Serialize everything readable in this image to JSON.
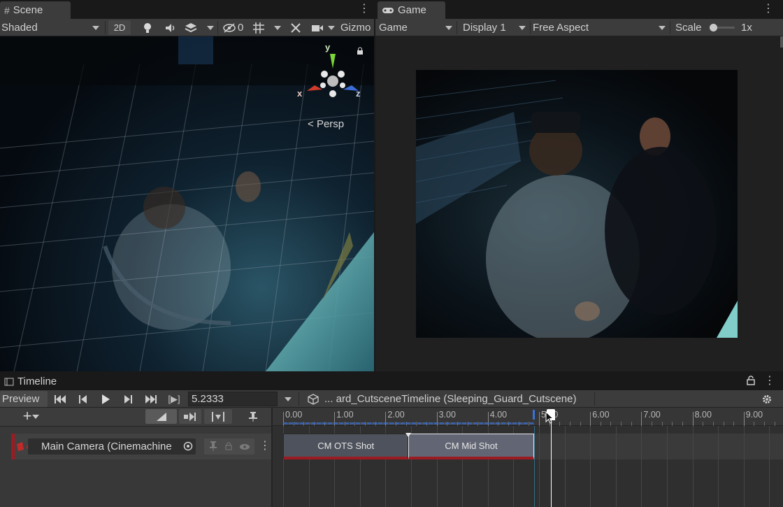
{
  "scene": {
    "tab_label": "Scene",
    "shading_mode": "Shaded",
    "btn_2d": "2D",
    "hidden_count": "0",
    "gizmos_label": "Gizmo",
    "axis_y": "y",
    "axis_x": "x",
    "axis_z": "z",
    "projection_label": "Persp"
  },
  "game": {
    "tab_label": "Game",
    "view_mode": "Game",
    "display": "Display 1",
    "aspect": "Free Aspect",
    "scale_label": "Scale",
    "scale_value": "1x",
    "scale_slider_fraction": 0.05
  },
  "timeline": {
    "tab_label": "Timeline",
    "preview_label": "Preview",
    "current_time": "5.2333",
    "asset_path": "... ard_CutsceneTimeline (Sleeping_Guard_Cutscene)",
    "ruler_labels": [
      "0.00",
      "1.00",
      "2.00",
      "3.00",
      "4.00",
      "5.00",
      "6.00",
      "7.00",
      "8.00",
      "9.00"
    ],
    "track_name": "Main Camera (Cinemachine",
    "clips": [
      {
        "label": "CM OTS Shot",
        "start": 0.0,
        "end": 2.45
      },
      {
        "label": "CM Mid Shot",
        "start": 2.45,
        "end": 4.9
      }
    ],
    "playhead_time": 5.2333,
    "accent_color": "#9b1b22",
    "selection_color": "#3a72d8"
  }
}
